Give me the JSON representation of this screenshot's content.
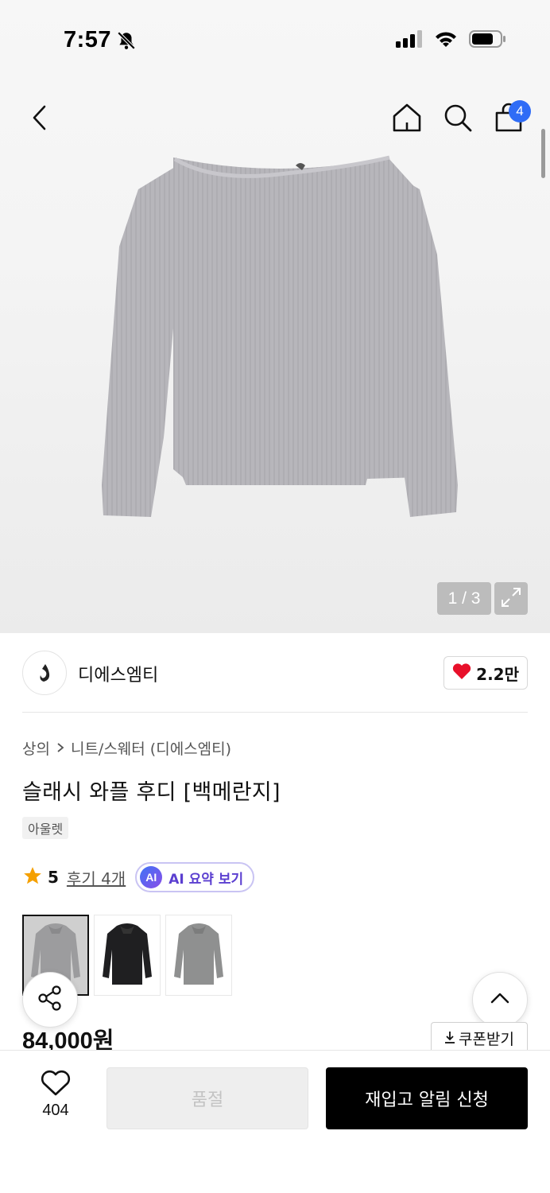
{
  "status_bar": {
    "time": "7:57"
  },
  "nav": {
    "cart_count": "4"
  },
  "gallery": {
    "counter": "1 / 3"
  },
  "brand": {
    "name": "디에스엠티",
    "like_count": "2.2만"
  },
  "breadcrumb": {
    "category": "상의",
    "subcategory": "니트/스웨터 (디에스엠티)"
  },
  "product": {
    "title": "슬래시 와플 후디 [백메란지]",
    "tag": "아울렛",
    "rating": "5",
    "reviews_label": "후기 4개",
    "ai_badge": "AI",
    "ai_summary_label": "AI 요약 보기",
    "price": "84,000원"
  },
  "actions": {
    "coupon_label": "쿠폰받기",
    "wish_count": "404",
    "sold_out_label": "품절",
    "restock_label": "재입고 알림 신청"
  },
  "colors": {
    "accent_blue": "#2f6cf6",
    "heart_red": "#e8102a",
    "star_orange": "#f5a000",
    "ai_purple": "#5b3fd0"
  },
  "icons": [
    "back-icon",
    "home-icon",
    "search-icon",
    "bag-icon",
    "expand-icon",
    "heart-icon",
    "star-icon",
    "share-icon",
    "chevron-up-icon",
    "download-icon"
  ]
}
